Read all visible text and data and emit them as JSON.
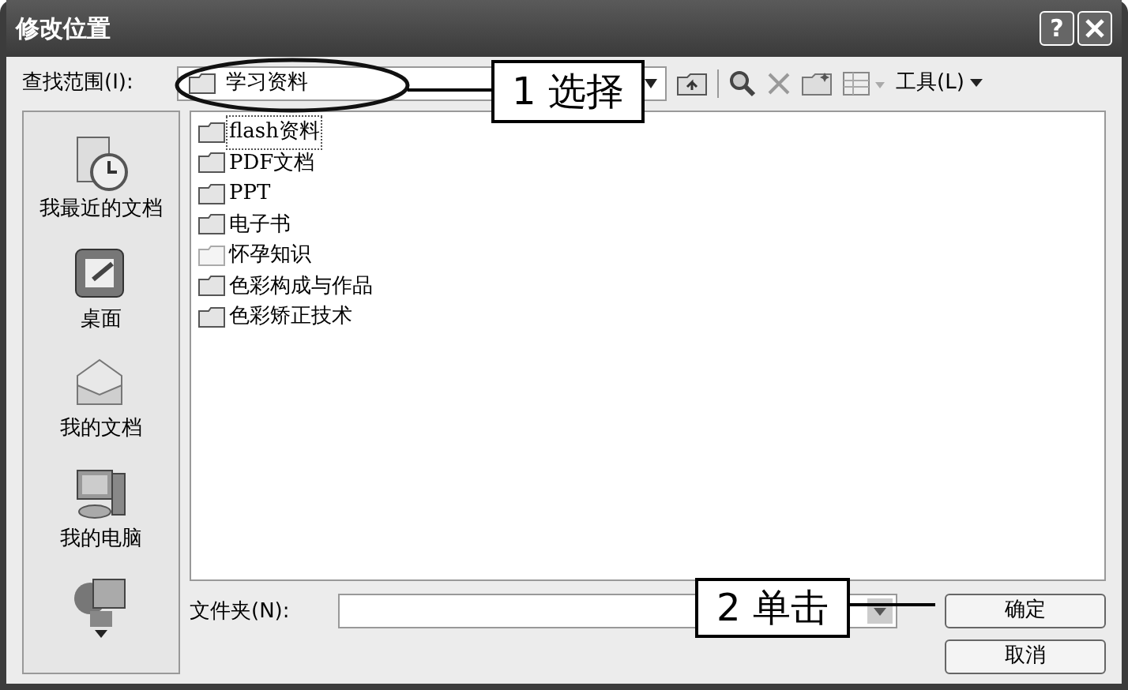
{
  "window": {
    "title": "修改位置",
    "help": "?"
  },
  "toolbar": {
    "look_in_label": "查找范围(I):",
    "look_in_value": "学习资料",
    "tools_menu": "工具(L)"
  },
  "places": [
    {
      "label": "我最近的文档",
      "kind": "recent"
    },
    {
      "label": "桌面",
      "kind": "desktop"
    },
    {
      "label": "我的文档",
      "kind": "documents"
    },
    {
      "label": "我的电脑",
      "kind": "computer"
    },
    {
      "kind": "network"
    }
  ],
  "files": [
    {
      "name": "flash资料",
      "focused": true,
      "hidden": false
    },
    {
      "name": "PDF文档",
      "focused": false,
      "hidden": false
    },
    {
      "name": "PPT",
      "focused": false,
      "hidden": false
    },
    {
      "name": "电子书",
      "focused": false,
      "hidden": false
    },
    {
      "name": "怀孕知识",
      "focused": false,
      "hidden": true
    },
    {
      "name": "色彩构成与作品",
      "focused": false,
      "hidden": false
    },
    {
      "name": "色彩矫正技术",
      "focused": false,
      "hidden": false
    }
  ],
  "folder_field": {
    "label": "文件夹(N):"
  },
  "buttons": [
    {
      "label": "确定"
    },
    {
      "label": "取消"
    }
  ],
  "callouts": [
    {
      "number": "1",
      "text": "选择"
    },
    {
      "number": "2",
      "text": "单击"
    }
  ]
}
